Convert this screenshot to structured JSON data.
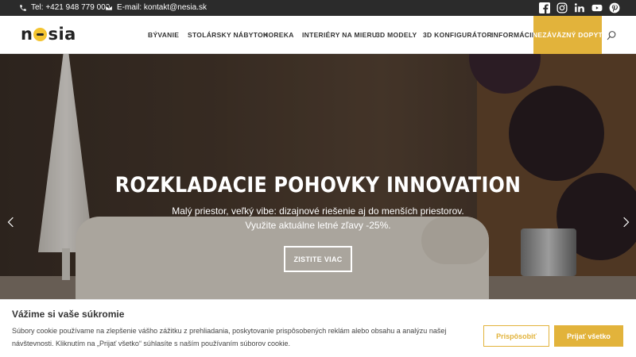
{
  "topbar": {
    "phone": "Tel: +421 948 779 000",
    "email": "E-mail: kontakt@nesia.sk",
    "social": [
      "facebook-icon",
      "instagram-icon",
      "linkedin-icon",
      "youtube-icon",
      "pinterest-icon"
    ]
  },
  "header": {
    "logo_left": "n",
    "logo_right": "sia",
    "nav": [
      "BÝVANIE",
      "STOLÁRSKY NÁBYTOK",
      "HOREKA",
      "INTERIÉRY NA MIERU",
      "3D MODELY",
      "3D KONFIGURÁTOR",
      "INFORMÁCIE"
    ],
    "cta": "NEZÁVÄZNÝ DOPYT"
  },
  "hero": {
    "title": "ROZKLADACIE POHOVKY INNOVATION",
    "subtitle_line1": "Malý priestor, veľký vibe: dizajnové riešenie aj do menších priestorov.",
    "subtitle_line2": "Využite aktuálne letné zľavy -25%.",
    "button": "ZISTITE VIAC"
  },
  "cookie": {
    "title": "Vážime si vaše súkromie",
    "text_line1": "Súbory cookie používame na zlepšenie vášho zážitku z prehliadania, poskytovanie prispôsobených reklám alebo obsahu a analýzu našej",
    "text_line2": "návštevnosti. Kliknutím na „Prijať všetko“ súhlasíte s naším používaním súborov cookie.",
    "customize": "Prispôsobiť",
    "accept": "Prijať všetko"
  },
  "colors": {
    "accent": "#e2b33b",
    "topbar": "#2b2b2b"
  }
}
